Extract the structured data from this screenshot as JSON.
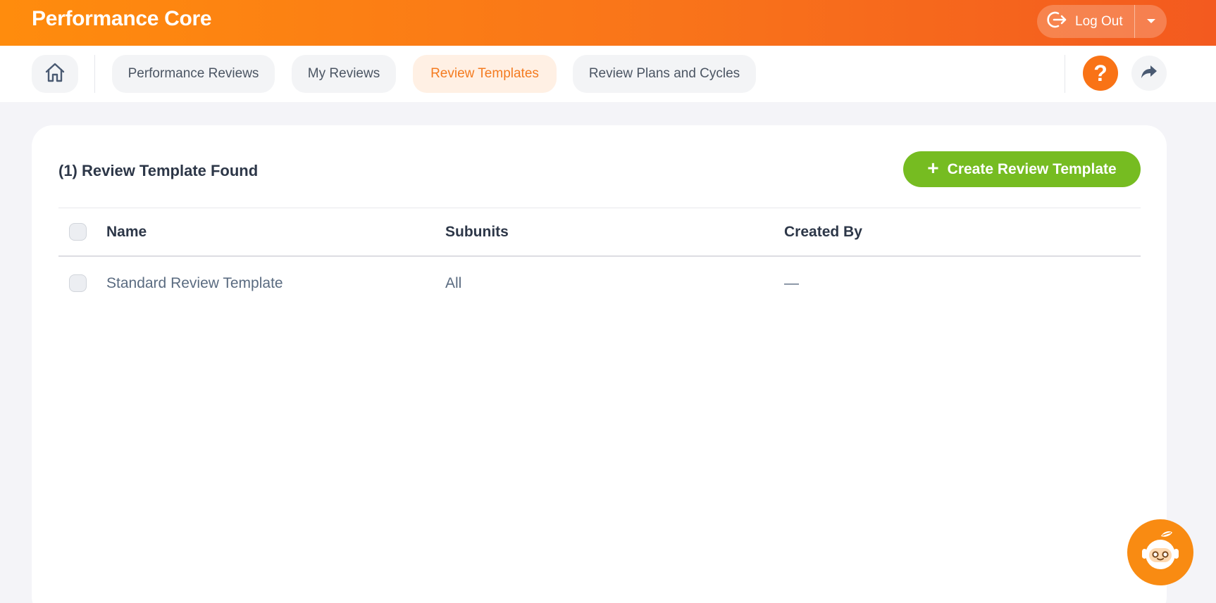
{
  "header": {
    "app_title": "Performance Core",
    "logout_label": "Log Out"
  },
  "nav": {
    "tabs": [
      {
        "label": "Performance Reviews",
        "active": false
      },
      {
        "label": "My Reviews",
        "active": false
      },
      {
        "label": "Review Templates",
        "active": true
      },
      {
        "label": "Review Plans and Cycles",
        "active": false
      }
    ],
    "help_label": "?"
  },
  "main": {
    "results_title": "(1) Review Template Found",
    "create_button_label": "Create Review Template",
    "columns": [
      "Name",
      "Subunits",
      "Created By"
    ],
    "rows": [
      {
        "name": "Standard Review Template",
        "subunits": "All",
        "created_by": "—"
      }
    ]
  },
  "colors": {
    "brand_orange": "#f97316",
    "active_tab_text": "#f47b20",
    "create_green": "#76bc21"
  },
  "icons": {
    "home": "home-icon",
    "logout": "logout-icon",
    "caret": "caret-down-icon",
    "help": "help-icon",
    "share": "share-icon",
    "assistant": "assistant-bot-icon"
  }
}
